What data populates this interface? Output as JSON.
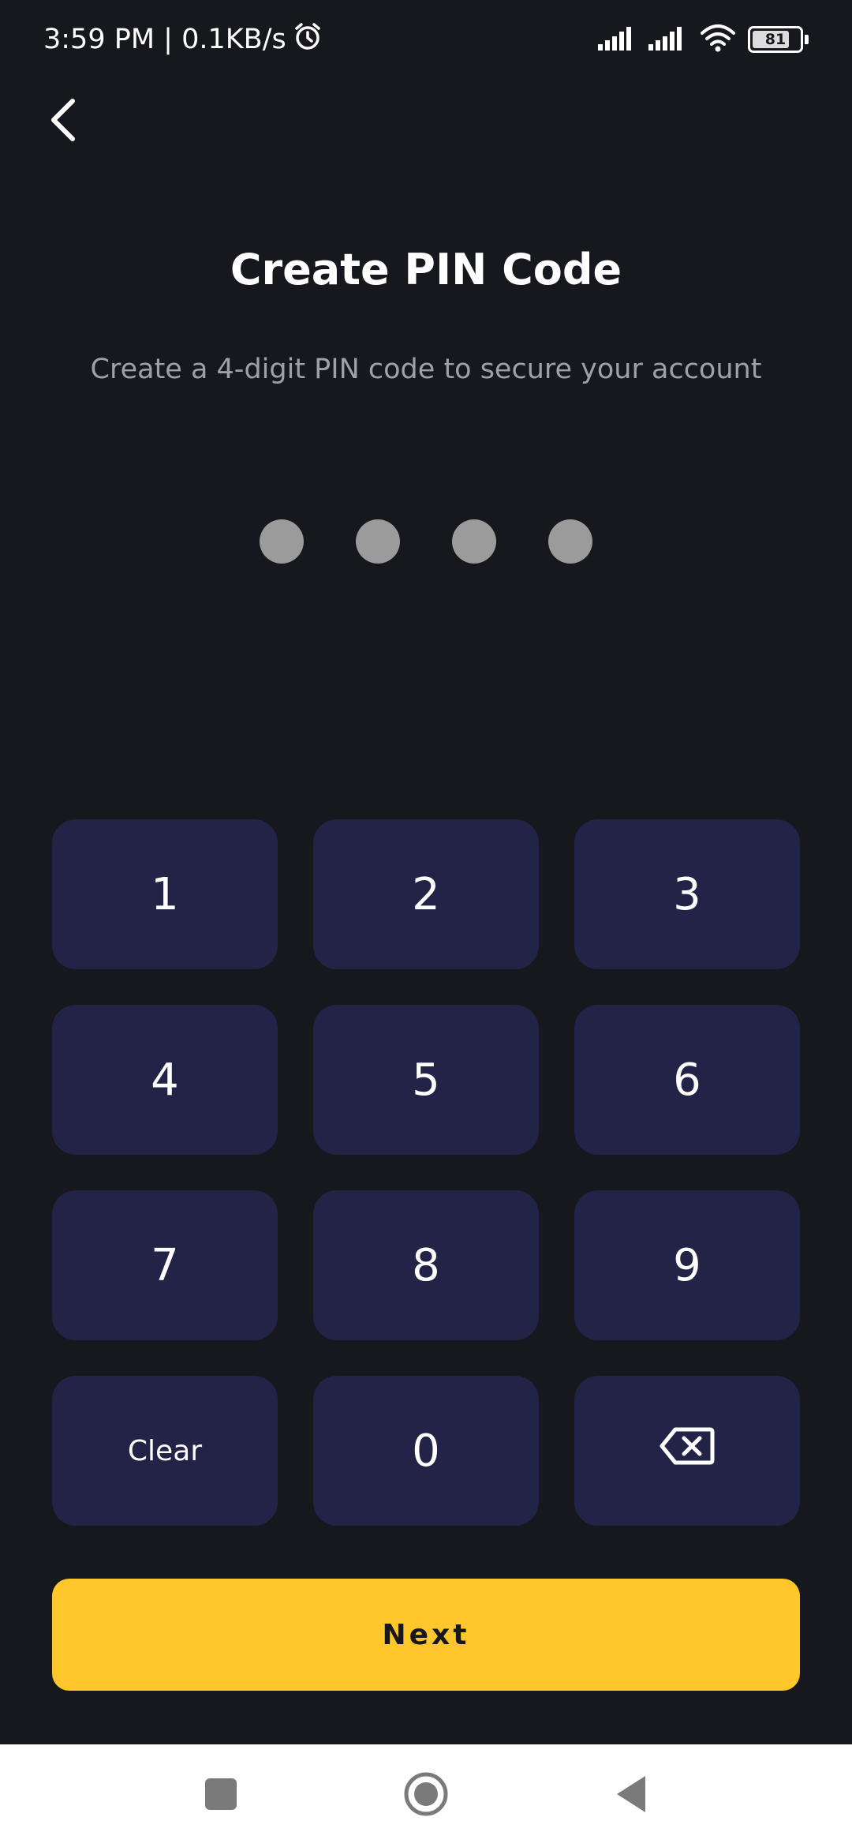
{
  "status_bar": {
    "time_speed": "3:59 PM | 0.1KB/s",
    "battery_level": "81",
    "icons": [
      "alarm-icon",
      "signal-icon",
      "signal-icon",
      "wifi-icon",
      "battery-icon"
    ]
  },
  "header": {
    "back_icon": "chevron-left-icon",
    "title": "Create PIN Code",
    "subtitle": "Create a 4-digit PIN code to secure your account"
  },
  "pin": {
    "length": 4,
    "entered": 0,
    "dot_color": "#9b9b9b"
  },
  "keypad": {
    "keys": [
      "1",
      "2",
      "3",
      "4",
      "5",
      "6",
      "7",
      "8",
      "9",
      "Clear",
      "0"
    ],
    "backspace_icon": "backspace-icon",
    "key_color": "#222346"
  },
  "actions": {
    "next_label": "Next",
    "next_color": "#ffc72c"
  },
  "nav_bar": {
    "icons": [
      "recent-apps-icon",
      "home-icon",
      "back-icon"
    ]
  }
}
